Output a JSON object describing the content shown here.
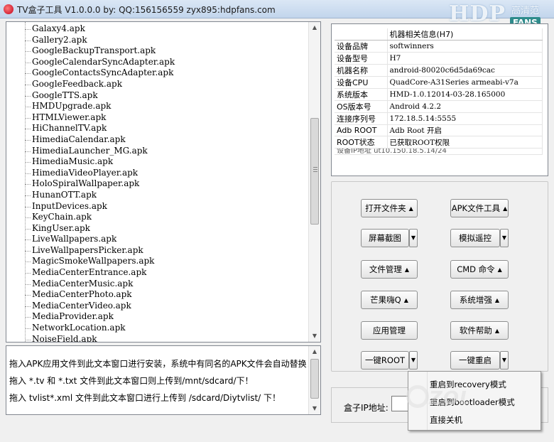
{
  "window": {
    "title": "TV盒子工具 V1.0.0.0 by: QQ:156156559  zyx895:hdpfans.com"
  },
  "logo": {
    "main": "HDP",
    "cn": "高清范",
    "badge": "FANS"
  },
  "app_list": [
    "Galaxy4.apk",
    "Gallery2.apk",
    "GoogleBackupTransport.apk",
    "GoogleCalendarSyncAdapter.apk",
    "GoogleContactsSyncAdapter.apk",
    "GoogleFeedback.apk",
    "GoogleTTS.apk",
    "HMDUpgrade.apk",
    "HTMLViewer.apk",
    "HiChannelTV.apk",
    "HimediaCalendar.apk",
    "HimediaLauncher_MG.apk",
    "HimediaMusic.apk",
    "HimediaVideoPlayer.apk",
    "HoloSpiralWallpaper.apk",
    "HunanOTT.apk",
    "InputDevices.apk",
    "KeyChain.apk",
    "KingUser.apk",
    "LiveWallpapers.apk",
    "LiveWallpapersPicker.apk",
    "MagicSmokeWallpapers.apk",
    "MediaCenterEntrance.apk",
    "MediaCenterMusic.apk",
    "MediaCenterPhoto.apk",
    "MediaCenterVideo.apk",
    "MediaProvider.apk",
    "NetworkLocation.apk",
    "NoiseField.apk"
  ],
  "instructions": [
    "拖入APK应用文件到此文本窗口进行安装，系统中有同名的APK文件会自动替换！",
    "拖入 *.tv 和 *.txt 文件到此文本窗口则上传到/mnt/sdcard/下！",
    "拖入 tvlist*.xml 文件到此文本窗口进行上传到 /sdcard/Diytvlist/ 下！"
  ],
  "device_info": {
    "header": "机器相关信息(H7)",
    "rows": [
      {
        "key": "设备品牌",
        "value": "softwinners"
      },
      {
        "key": "设备型号",
        "value": "H7"
      },
      {
        "key": "机器名称",
        "value": "android-80020c6d5da69cac"
      },
      {
        "key": "设备CPU",
        "value": "QuadCore-A31Series  armeabi-v7a"
      },
      {
        "key": "系统版本",
        "value": "HMD-1.0.12014-03-28.165000"
      },
      {
        "key": "OS版本号",
        "value": "Android  4.2.2"
      },
      {
        "key": "连接序列号",
        "value": "172.18.5.14:5555"
      },
      {
        "key": "Adb ROOT",
        "value": "Adb Root 开启"
      },
      {
        "key": "ROOT状态",
        "value": "已获取ROOT权限"
      }
    ],
    "partial_row": "设备IP地址    ut10.150.18.5.14/24",
    "row_marker": ":"
  },
  "buttons": {
    "open_folder": "打开文件夹",
    "apk_tools": "APK文件工具",
    "screenshot": "屏幕截图",
    "remote_sim": "模拟遥控",
    "file_manager": "文件管理",
    "cmd": "CMD 命令",
    "mango": "芒果嗨Q",
    "sys_enhance": "系统增强",
    "app_manager": "应用管理",
    "software_help": "软件帮助",
    "one_key_root": "一键ROOT",
    "one_key_reboot": "一键重启"
  },
  "ip": {
    "label": "盒子IP地址:",
    "value": ""
  },
  "context_menu": {
    "items": [
      "重启到recovery模式",
      "重启到bootloader模式",
      "直接关机"
    ]
  },
  "watermark": "ZOL"
}
